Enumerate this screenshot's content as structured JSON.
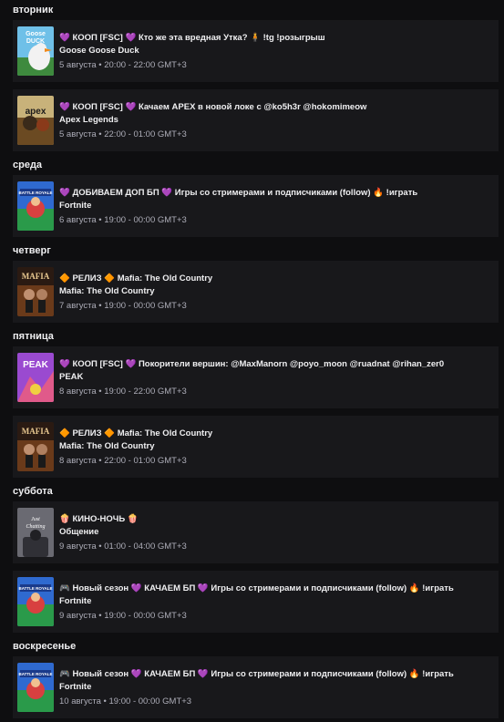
{
  "days": [
    {
      "label": "вторник",
      "events": [
        {
          "title": "💜 КООП [FSC] 💜 Кто же эта вредная Утка? 🧍 !tg !розыгрыш",
          "game": "Goose Goose Duck",
          "time": "5 августа • 20:00 - 22:00 GMT+3",
          "cover": "goose"
        },
        {
          "title": "💜 КООП [FSC] 💜 Качаем APEX в новой локе с @ko5h3r @hokomimeow",
          "game": "Apex Legends",
          "time": "5 августа • 22:00 - 01:00 GMT+3",
          "cover": "apex"
        }
      ]
    },
    {
      "label": "среда",
      "events": [
        {
          "title": "💜 ДОБИВАЕМ ДОП БП 💜 Игры со стримерами и подписчиками (follow) 🔥 !играть",
          "game": "Fortnite",
          "time": "6 августа • 19:00 - 00:00 GMT+3",
          "cover": "fortnite"
        }
      ]
    },
    {
      "label": "четверг",
      "events": [
        {
          "title": "🔶 РЕЛИЗ 🔶 Mafia: The Old Country",
          "game": "Mafia: The Old Country",
          "time": "7 августа • 19:00 - 00:00 GMT+3",
          "cover": "mafia"
        }
      ]
    },
    {
      "label": "пятница",
      "events": [
        {
          "title": "💜 КООП [FSC] 💜 Покорители вершин: @MaxManorn @poyo_moon @ruadnat @rihan_zer0",
          "game": "PEAK",
          "time": "8 августа • 19:00 - 22:00 GMT+3",
          "cover": "peak"
        },
        {
          "title": "🔶 РЕЛИЗ 🔶 Mafia: The Old Country",
          "game": "Mafia: The Old Country",
          "time": "8 августа • 22:00 - 01:00 GMT+3",
          "cover": "mafia"
        }
      ]
    },
    {
      "label": "суббота",
      "events": [
        {
          "title": "🍿 КИНО-НОЧЬ 🍿",
          "game": "Общение",
          "time": "9 августа • 01:00 - 04:00 GMT+3",
          "cover": "chat"
        },
        {
          "title": "🎮 Новый сезон 💜 КАЧАЕМ БП 💜 Игры со стримерами и подписчиками (follow) 🔥 !играть",
          "game": "Fortnite",
          "time": "9 августа • 19:00 - 00:00 GMT+3",
          "cover": "fortnite"
        }
      ]
    },
    {
      "label": "воскресенье",
      "events": [
        {
          "title": "🎮 Новый сезон 💜 КАЧАЕМ БП 💜 Игры со стримерами и подписчиками (follow) 🔥 !играть",
          "game": "Fortnite",
          "time": "10 августа • 19:00 - 00:00 GMT+3",
          "cover": "fortnite"
        }
      ]
    }
  ],
  "covers": {
    "goose": {
      "text_1": "Goose",
      "text_2": "DUCK",
      "bg": "#2f7a3e"
    },
    "apex": {
      "text_1": "apex",
      "bg": "#7a5a2f"
    },
    "fortnite": {
      "text_1": "BATTLE ROYALE",
      "bg": "#3b6fd0"
    },
    "mafia": {
      "text_1": "MAFIA",
      "bg": "#2a1a12"
    },
    "peak": {
      "text_1": "PEAK",
      "bg": "#7a3fb0"
    },
    "chat": {
      "text_1": "Just Chatting",
      "bg": "#4a4a52"
    }
  }
}
